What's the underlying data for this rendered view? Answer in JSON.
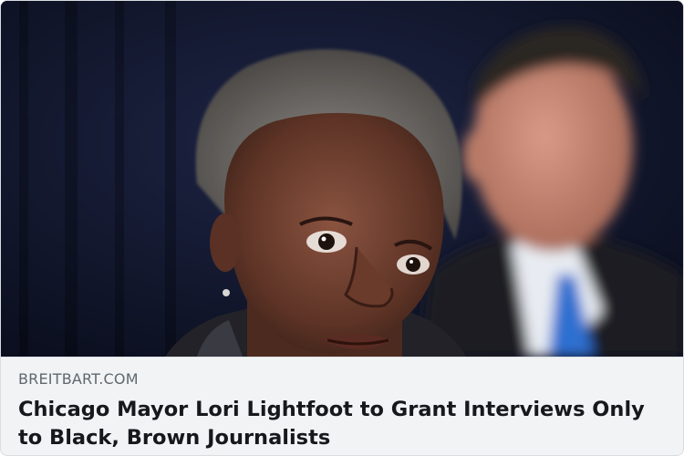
{
  "link_preview": {
    "image_alt": "Chicago Mayor Lori Lightfoot with a man in a suit and blue tie blurred in the background",
    "domain": "BREITBART.COM",
    "title": "Chicago Mayor Lori Lightfoot to Grant Interviews Only to Black, Brown Journalists"
  },
  "colors": {
    "background_curtain": "#141a33",
    "caption_background": "#f1f3f4",
    "domain_text": "#5f6770",
    "title_text": "#16191c",
    "tie_blue": "#2f6fd0"
  }
}
